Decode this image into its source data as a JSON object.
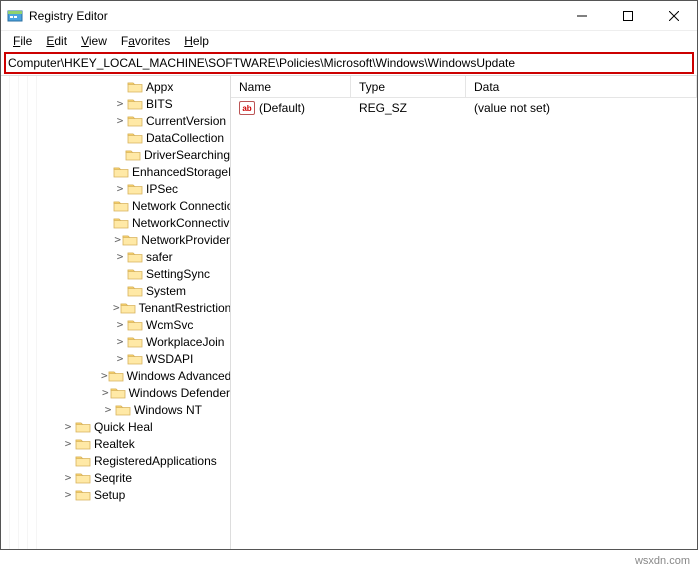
{
  "window": {
    "title": "Registry Editor"
  },
  "menu": {
    "file": "File",
    "edit": "Edit",
    "view": "View",
    "favorites": "Favorites",
    "help": "Help"
  },
  "address": {
    "path": "Computer\\HKEY_LOCAL_MACHINE\\SOFTWARE\\Policies\\Microsoft\\Windows\\WindowsUpdate"
  },
  "tree": [
    {
      "label": "Appx",
      "indent": 4,
      "exp": ""
    },
    {
      "label": "BITS",
      "indent": 4,
      "exp": ">"
    },
    {
      "label": "CurrentVersion",
      "indent": 4,
      "exp": ">"
    },
    {
      "label": "DataCollection",
      "indent": 4,
      "exp": ""
    },
    {
      "label": "DriverSearching",
      "indent": 4,
      "exp": ""
    },
    {
      "label": "EnhancedStorageDevices",
      "indent": 4,
      "exp": ""
    },
    {
      "label": "IPSec",
      "indent": 4,
      "exp": ">"
    },
    {
      "label": "Network Connections",
      "indent": 4,
      "exp": ""
    },
    {
      "label": "NetworkConnectivityStatusIndicator",
      "indent": 4,
      "exp": ""
    },
    {
      "label": "NetworkProvider",
      "indent": 4,
      "exp": ">"
    },
    {
      "label": "safer",
      "indent": 4,
      "exp": ">"
    },
    {
      "label": "SettingSync",
      "indent": 4,
      "exp": ""
    },
    {
      "label": "System",
      "indent": 4,
      "exp": ""
    },
    {
      "label": "TenantRestrictions",
      "indent": 4,
      "exp": ">"
    },
    {
      "label": "WcmSvc",
      "indent": 4,
      "exp": ">"
    },
    {
      "label": "WorkplaceJoin",
      "indent": 4,
      "exp": ">"
    },
    {
      "label": "WSDAPI",
      "indent": 4,
      "exp": ">"
    },
    {
      "label": "Windows Advanced Threat Protection",
      "indent": 3,
      "exp": ">"
    },
    {
      "label": "Windows Defender",
      "indent": 3,
      "exp": ">"
    },
    {
      "label": "Windows NT",
      "indent": 3,
      "exp": ">"
    },
    {
      "label": "Quick Heal",
      "indent": 1,
      "exp": ">"
    },
    {
      "label": "Realtek",
      "indent": 1,
      "exp": ">"
    },
    {
      "label": "RegisteredApplications",
      "indent": 1,
      "exp": ""
    },
    {
      "label": "Seqrite",
      "indent": 1,
      "exp": ">"
    },
    {
      "label": "Setup",
      "indent": 1,
      "exp": ">"
    }
  ],
  "list": {
    "columns": {
      "name": "Name",
      "type": "Type",
      "data": "Data"
    },
    "rows": [
      {
        "name": "(Default)",
        "type": "REG_SZ",
        "data": "(value not set)",
        "icon": "ab"
      }
    ]
  },
  "watermark": "wsxdn.com"
}
